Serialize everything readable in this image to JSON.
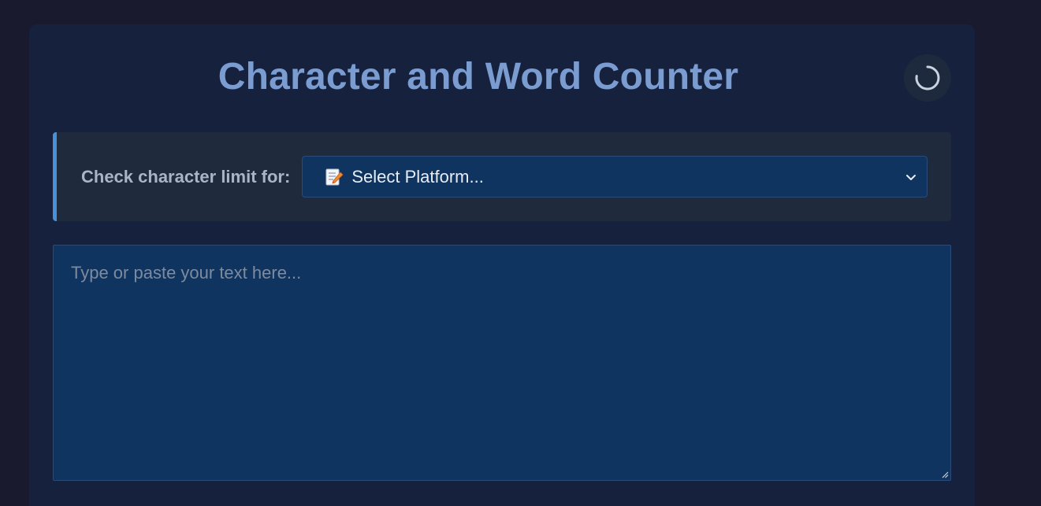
{
  "header": {
    "title": "Character and Word Counter",
    "theme_toggle_icon": "loading-spinner-icon"
  },
  "platform": {
    "label": "Check character limit for:",
    "selected_icon": "memo-icon",
    "selected_text": "Select Platform..."
  },
  "editor": {
    "placeholder": "Type or paste your text here...",
    "value": ""
  },
  "colors": {
    "background": "#1a1a2e",
    "card": "#16213e",
    "accent": "#4a90d9",
    "title": "#7a9cd0",
    "input": "#0f3460"
  }
}
